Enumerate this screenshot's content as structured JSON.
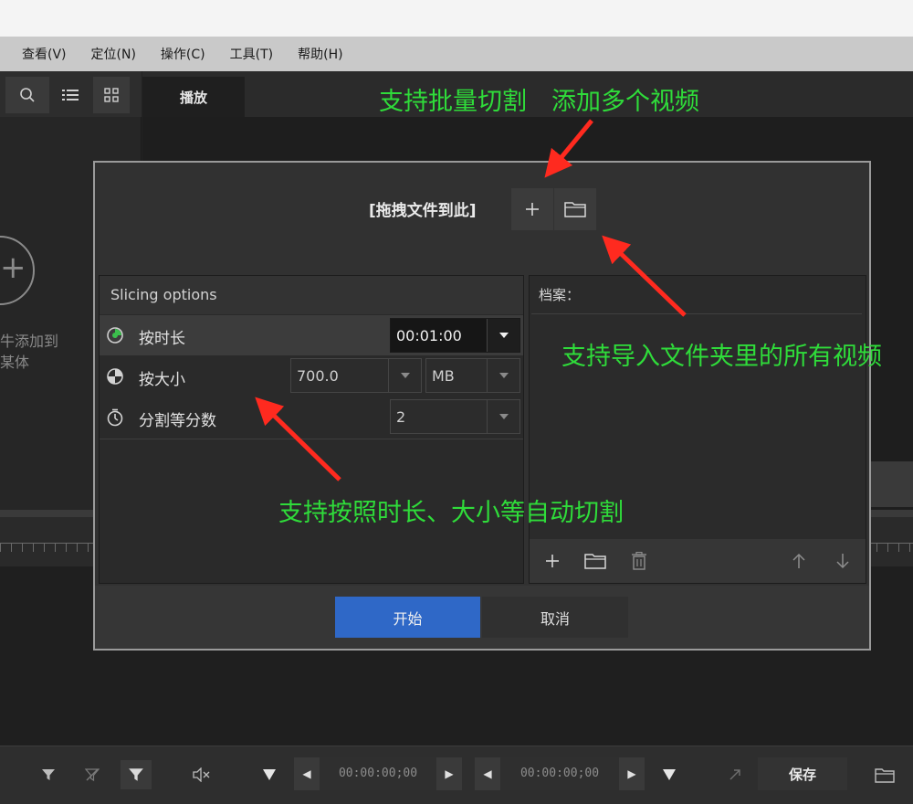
{
  "menubar": {
    "items": [
      "查看(V)",
      "定位(N)",
      "操作(C)",
      "工具(T)",
      "帮助(H)"
    ]
  },
  "left_panel": {
    "add_text_1": "牛添加到",
    "add_text_2": "某体"
  },
  "play_tab": {
    "label": "播放"
  },
  "dialog": {
    "drop_label": "[拖拽文件到此]",
    "slicing_header": "Slicing options",
    "options": [
      {
        "label": "按时长",
        "value": "00:01:00"
      },
      {
        "label": "按大小",
        "value": "700.0",
        "unit": "MB"
      },
      {
        "label": "分割等分数",
        "value": "2"
      }
    ],
    "files_header": "档案：",
    "start_label": "开始",
    "cancel_label": "取消"
  },
  "bottombar": {
    "timecode_in": "00:00:00;00",
    "timecode_out": "00:00:00;00",
    "save_label": "保存"
  },
  "annotations": {
    "batch": "支持批量切割　添加多个视频",
    "folder": "支持导入文件夹里的所有视频",
    "auto": "支持按照时长、大小等自动切割"
  },
  "colors": {
    "accent_blue": "#2f68c7",
    "annotation_green": "#2fdc3a",
    "arrow_red": "#ff2a1f"
  }
}
